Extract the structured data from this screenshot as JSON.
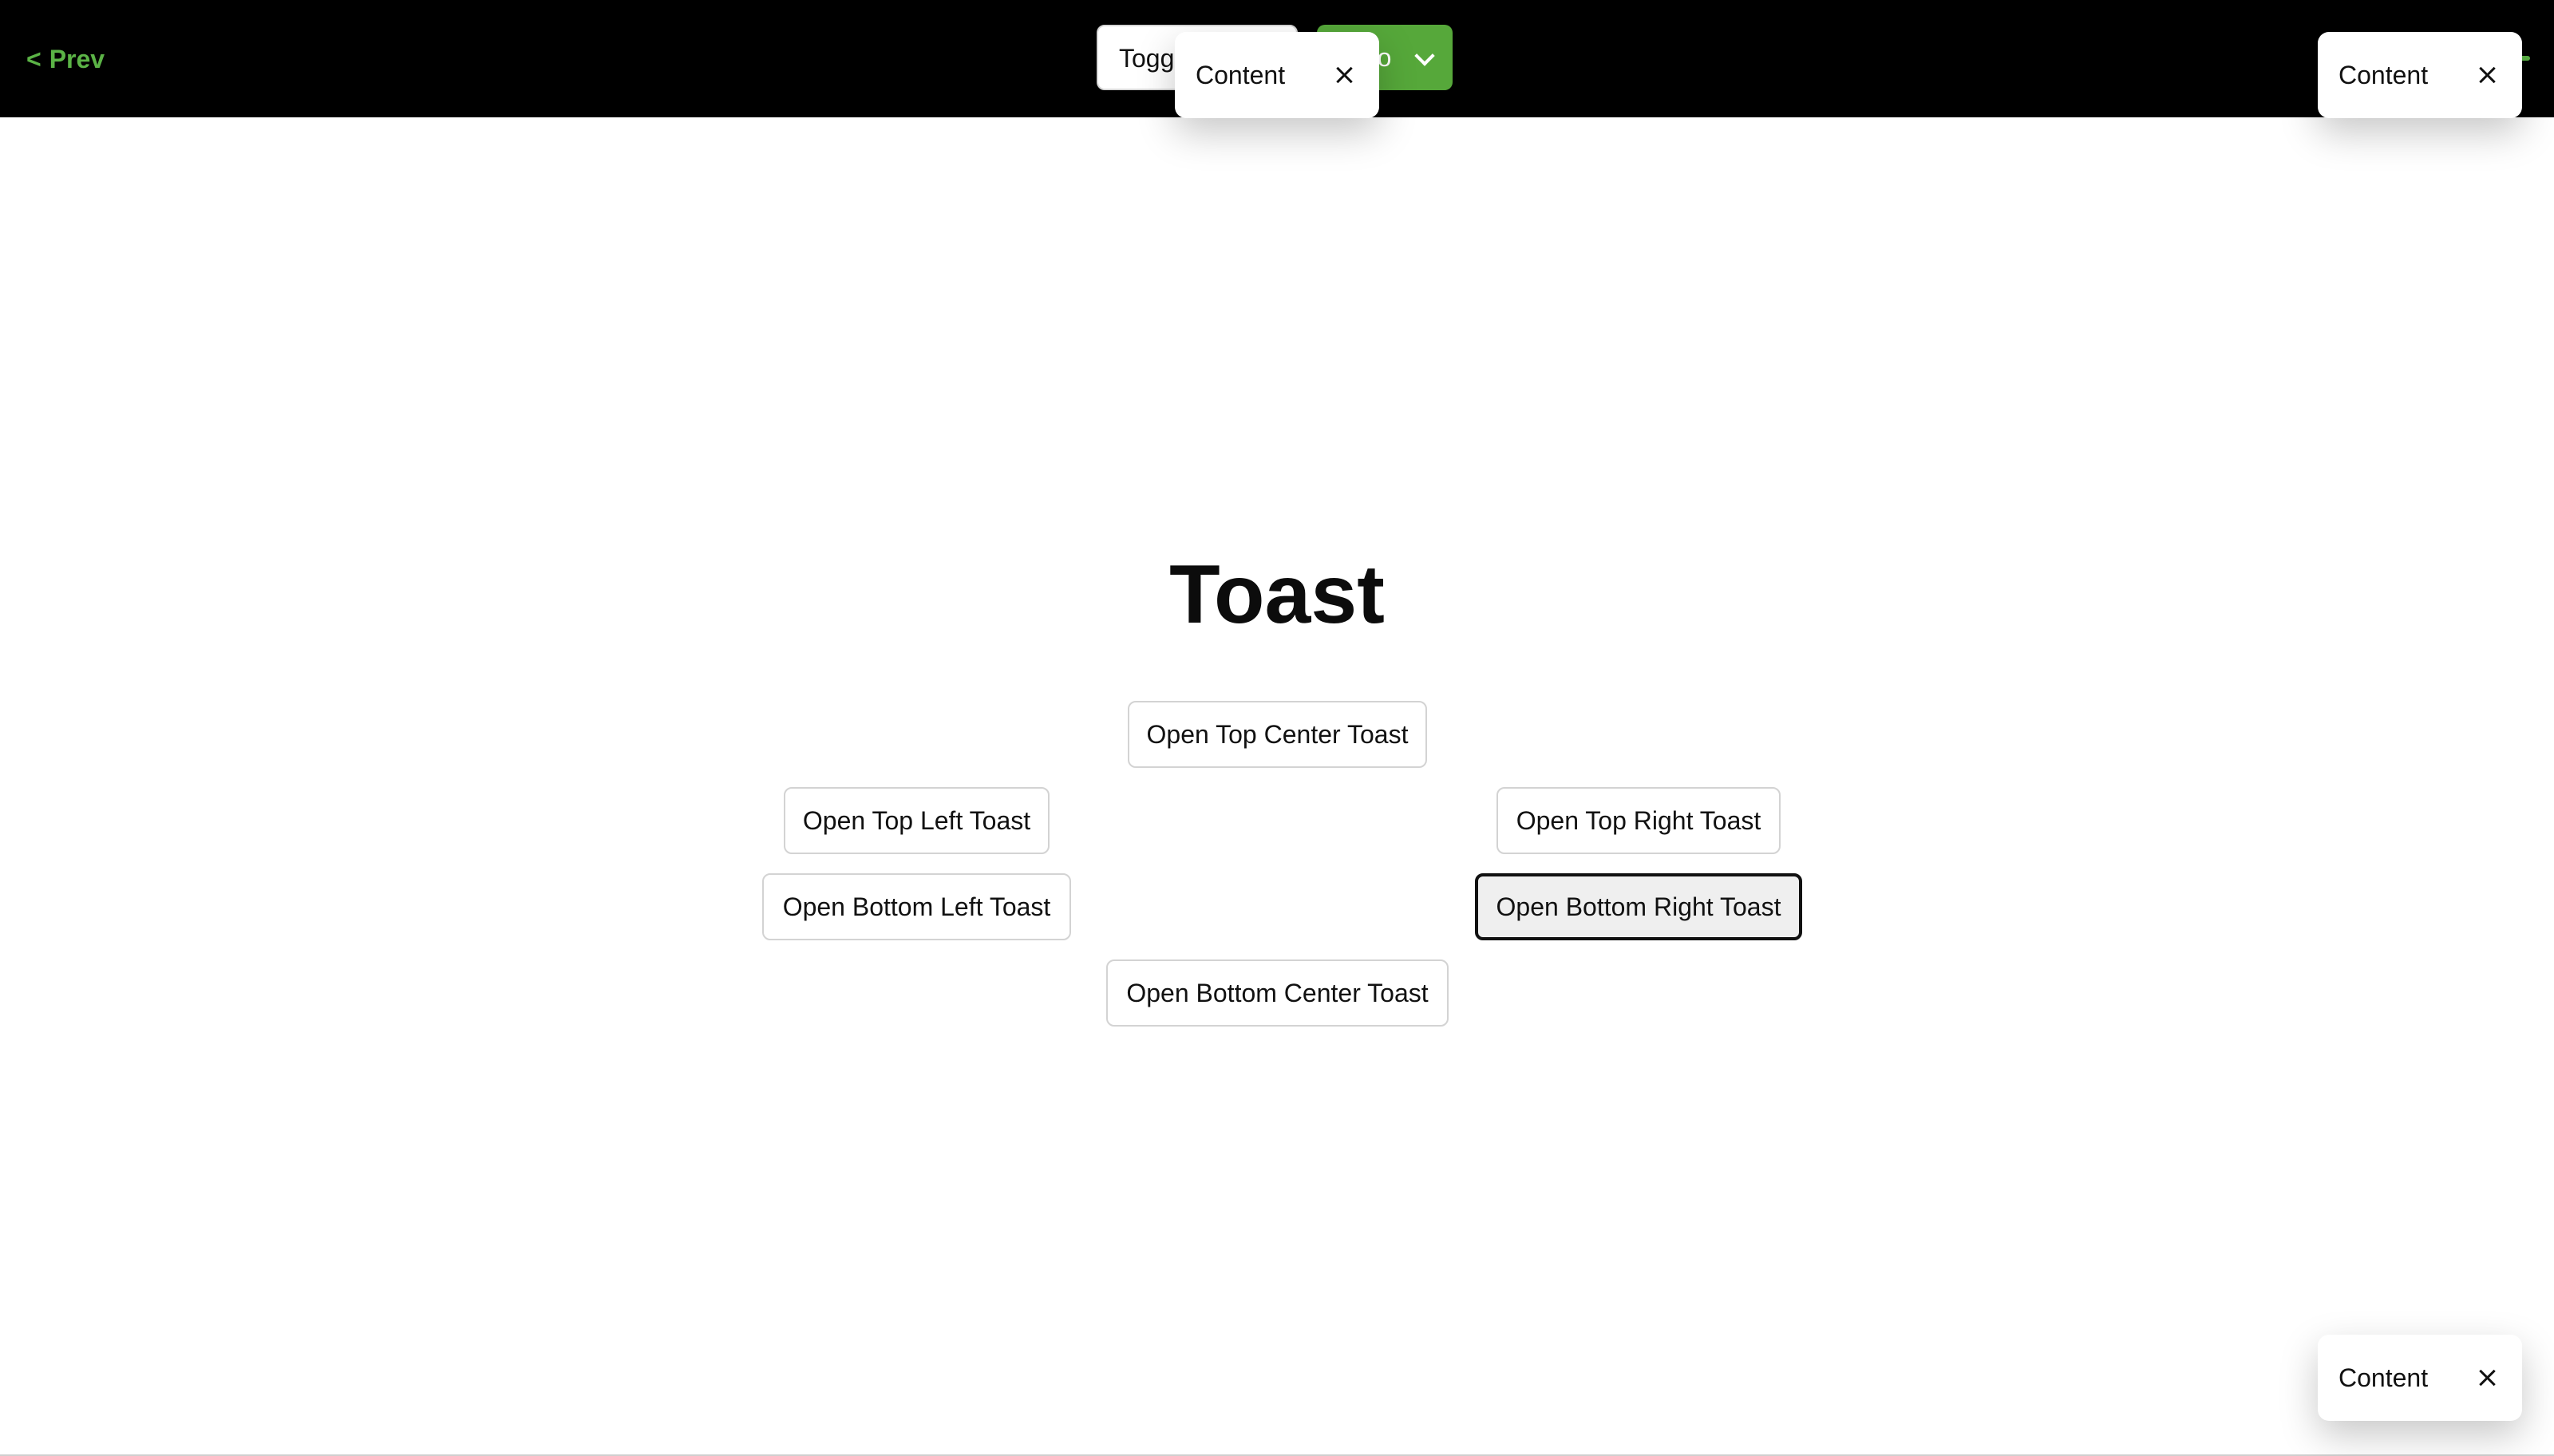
{
  "header": {
    "prev_label": "Prev",
    "prev_chevron": "<",
    "toggle_label": "Toggle",
    "goto_label": "Goto",
    "goto_icon": "chevron-down-icon",
    "accent_color": "#5bb346",
    "goto_color": "#56a83a"
  },
  "toasts": {
    "top_center": {
      "text": "Content",
      "close_icon": "close-icon"
    },
    "top_right": {
      "text": "Content",
      "close_icon": "close-icon"
    },
    "bottom_right": {
      "text": "Content",
      "close_icon": "close-icon"
    }
  },
  "main": {
    "title": "Toast",
    "buttons": {
      "top_center": "Open Top Center Toast",
      "top_left": "Open Top Left Toast",
      "top_right": "Open Top Right Toast",
      "bottom_left": "Open Bottom Left Toast",
      "bottom_right": "Open Bottom Right Toast",
      "bottom_center": "Open Bottom Center Toast"
    },
    "focused_button": "bottom_right"
  }
}
